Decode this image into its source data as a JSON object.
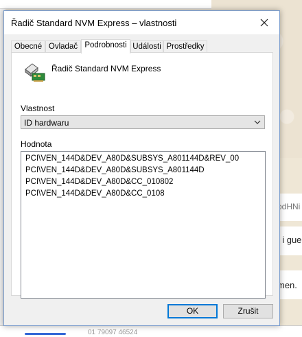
{
  "background": {
    "chat_snippets": [
      "odHNi",
      "t i gue",
      "men."
    ],
    "bottom_text": "01 79097 46524"
  },
  "dialog": {
    "title": "Řadič Standard NVM Express – vlastnosti",
    "tabs": [
      {
        "label": "Obecné"
      },
      {
        "label": "Ovladač"
      },
      {
        "label": "Podrobnosti",
        "active": true
      },
      {
        "label": "Události"
      },
      {
        "label": "Prostředky"
      }
    ],
    "device_name": "Řadič Standard NVM Express",
    "property_label": "Vlastnost",
    "property_selected": "ID hardwaru",
    "value_label": "Hodnota",
    "values": [
      "PCI\\VEN_144D&DEV_A80D&SUBSYS_A801144D&REV_00",
      "PCI\\VEN_144D&DEV_A80D&SUBSYS_A801144D",
      "PCI\\VEN_144D&DEV_A80D&CC_010802",
      "PCI\\VEN_144D&DEV_A80D&CC_0108"
    ],
    "ok_label": "OK",
    "cancel_label": "Zrušit"
  },
  "icons": {
    "close": "close-icon",
    "device": "storage-controller-icon",
    "dropdown": "chevron-down-icon"
  },
  "colors": {
    "accent": "#0078d7",
    "dialog_bg": "#f0f0f0",
    "panel_bg": "#ffffff"
  }
}
